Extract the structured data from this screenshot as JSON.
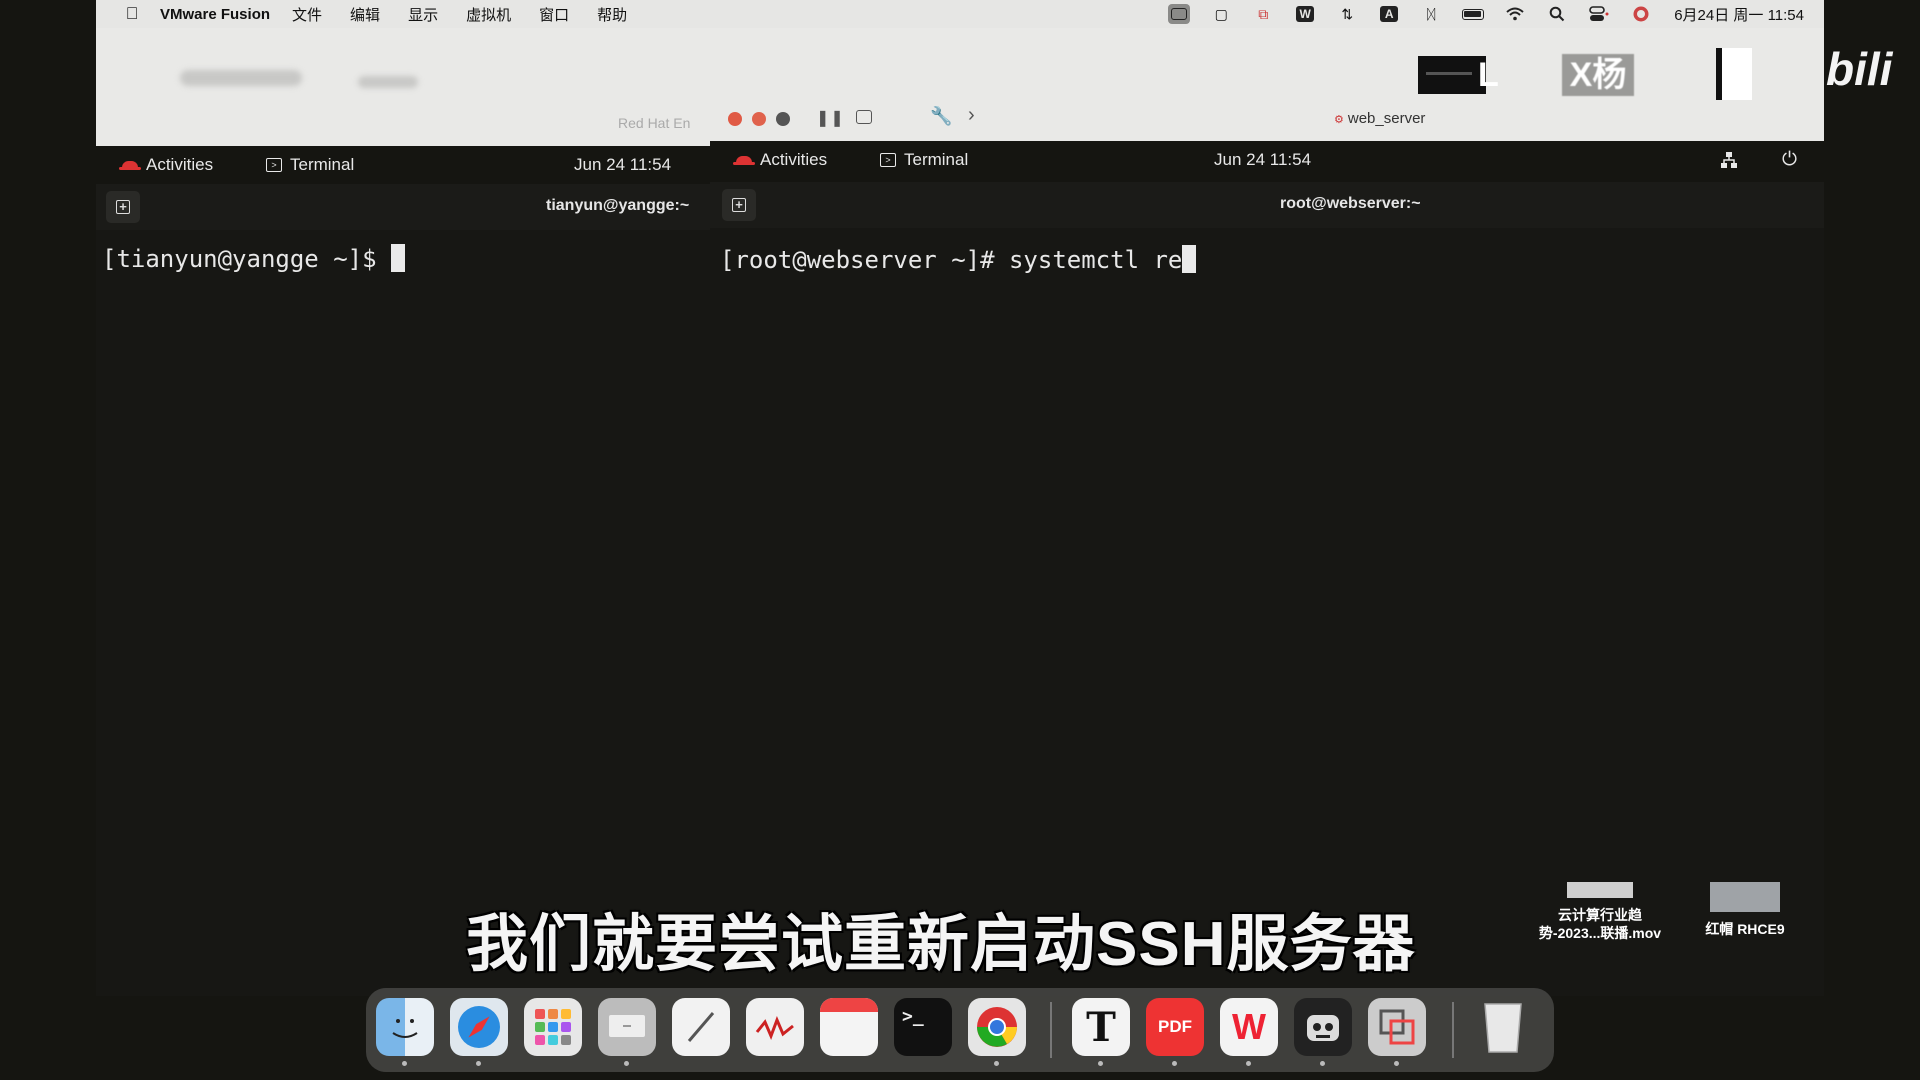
{
  "menubar": {
    "app_name": "VMware Fusion",
    "menus": [
      "文件",
      "编辑",
      "显示",
      "虚拟机",
      "窗口",
      "帮助"
    ],
    "status_icons": [
      "screen-mirror-icon",
      "video-camera-icon",
      "screenshot-tool-icon",
      "wps-icon",
      "sync-icon",
      "input-method-icon",
      "bluetooth-icon",
      "battery-icon",
      "wifi-icon",
      "search-icon",
      "control-center-icon",
      "siri-icon"
    ],
    "input_method_label": "A",
    "clock": "6月24日 周一  11:54"
  },
  "vmware": {
    "faded_tab": "Red Hat En",
    "active_tab": "web_server"
  },
  "thumbnails": {
    "thumb1_letter": "L",
    "thumb2_text": "X杨"
  },
  "watermark": "bili",
  "vm_left": {
    "activities": "Activities",
    "app": "Terminal",
    "clock": "Jun 24  11:54",
    "tab_title": "tianyun@yangge:~",
    "prompt": "[tianyun@yangge ~]$ "
  },
  "vm_right": {
    "activities": "Activities",
    "app": "Terminal",
    "clock": "Jun 24  11:54",
    "tab_title": "root@webserver:~",
    "prompt": "[root@webserver ~]# systemctl re"
  },
  "subtitle": "我们就要尝试重新启动SSH服务器",
  "desktop": [
    {
      "label_line1": "云计算行业趋",
      "label_line2": "势-2023...联播.mov"
    },
    {
      "label_line1": "红帽 RHCE9",
      "label_line2": ""
    }
  ],
  "dock": {
    "apps": [
      "finder-icon",
      "safari-icon",
      "launchpad-icon",
      "keynote-icon",
      "pencil-icon",
      "activity-monitor-icon",
      "calendar-icon",
      "terminal-icon",
      "chrome-icon",
      "typora-icon",
      "pdf-icon",
      "wps-icon",
      "robot-icon",
      "vmware-icon",
      "trash-icon"
    ],
    "typora_glyph": "T",
    "pdf_label": "PDF",
    "wps_glyph": "W",
    "terminal_glyph": ">_"
  }
}
